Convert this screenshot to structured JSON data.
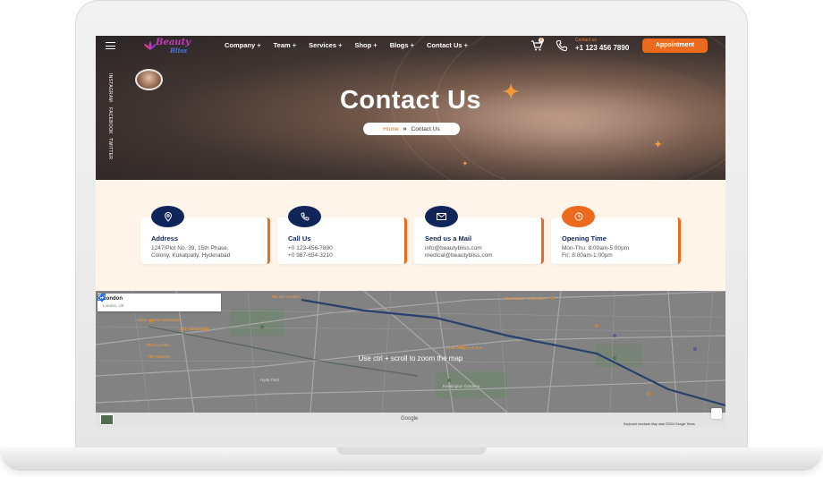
{
  "nav": {
    "logo_text": "Beauty",
    "logo_sub": "Bliss",
    "links": [
      "Company +",
      "Team +",
      "Services +",
      "Shop +",
      "Blogs +",
      "Contact Us +"
    ],
    "cart_count": "0",
    "contact_label": "Contact us",
    "contact_number": "+1 123 456 7890",
    "appointment_label": "Appointment"
  },
  "social": [
    "INSTAGRAM",
    "FACEBOOK",
    "TWITTER"
  ],
  "hero": {
    "title": "Contact Us",
    "breadcrumb_home": "Home",
    "breadcrumb_sep": "»",
    "breadcrumb_current": "Contact Us"
  },
  "cards": [
    {
      "title": "Address",
      "icon": "location-pin-icon",
      "lines": [
        "1247/Plot No. 39, 15th Phase,",
        "Colony, Kukatpally, Hyderabad"
      ]
    },
    {
      "title": "Call Us",
      "icon": "phone-icon",
      "lines": [
        "+0 123-456-7890",
        "+0 987-654-3210"
      ]
    },
    {
      "title": "Send us a Mail",
      "icon": "mail-icon",
      "lines": [
        "info@beautybliss.com",
        "medical@beautybliss.com"
      ]
    },
    {
      "title": "Opening Time",
      "icon": "clock-icon",
      "lines": [
        "Mon-Thu: 8:00am-5:00pm",
        "Fri: 8:00am-1:00pm"
      ]
    }
  ],
  "map": {
    "place": "London",
    "place_sub": "London, UK",
    "hint": "Use ctrl + scroll to zoom the map",
    "google": "Google",
    "terms": "Keyboard shortcuts   Map data ©2024 Google   Terms",
    "labels": [
      {
        "text": "The 411 London",
        "color": "#f39a3a"
      },
      {
        "text": "The Wallace Collection",
        "color": "#f39a3a"
      },
      {
        "text": "Hilton London Metropole",
        "color": "#f39a3a"
      },
      {
        "text": "The Marylebone",
        "color": "#f39a3a"
      },
      {
        "text": "The Ivy Café",
        "color": "#f39a3a"
      },
      {
        "text": "The Rookery",
        "color": "#f39a3a"
      },
      {
        "text": "Hotel Indigo London",
        "color": "#f39a3a"
      },
      {
        "text": "Kensington Gardens",
        "color": "#d9d9d9"
      },
      {
        "text": "Hyde Park",
        "color": "#d9d9d9"
      },
      {
        "text": "Old Street",
        "color": "#ffffff"
      },
      {
        "text": "The London Archive",
        "color": "#ffffff"
      }
    ]
  },
  "colors": {
    "accent": "#ec6a1c",
    "navy": "#10265a",
    "cream": "#fef4e9"
  }
}
